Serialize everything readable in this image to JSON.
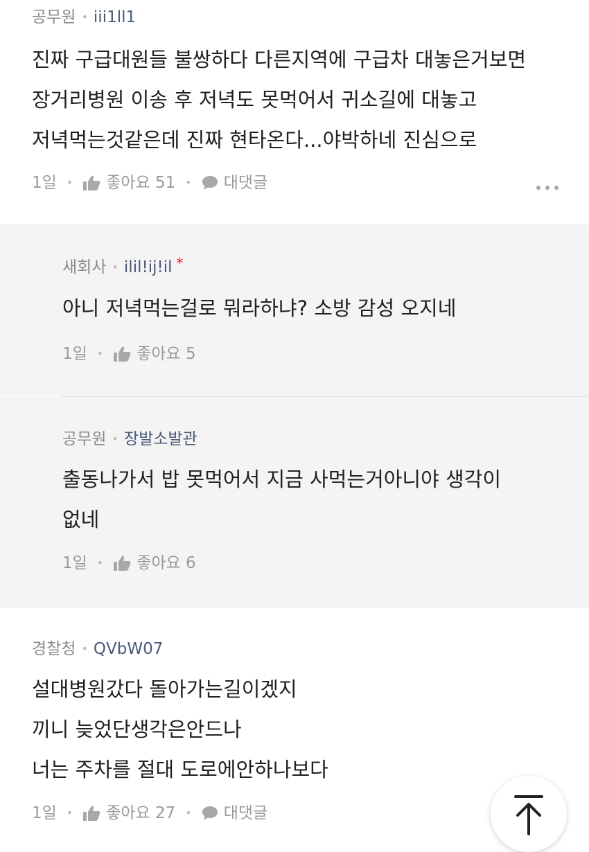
{
  "comments": [
    {
      "company": "공무원",
      "nickname": "iii1ll1",
      "body": "진짜 구급대원들 불쌍하다 다른지역에 구급차 대놓은거보면\n장거리병원 이송 후 저녁도 못먹어서 귀소길에 대놓고\n저녁먹는것같은데 진짜 현타온다...야박하네 진심으로",
      "time": "1일",
      "like_label": "좋아요 51",
      "reply_label": "대댓글"
    },
    {
      "company": "새회사",
      "nickname": "ilil!ij!il",
      "author_marker": "*",
      "body": "아니 저녁먹는걸로 뭐라하냐? 소방 감성 오지네",
      "time": "1일",
      "like_label": "좋아요 5"
    },
    {
      "company": "공무원",
      "nickname": "장발소발관",
      "body": "출동나가서 밥 못먹어서 지금 사먹는거아니야 생각이\n없네",
      "time": "1일",
      "like_label": "좋아요 6"
    },
    {
      "company": "경찰청",
      "nickname": "QVbW07",
      "body": "설대병원갔다 돌아가는길이겠지\n끼니 늦었단생각은안드나\n너는 주차를 절대 도로에안하나보다",
      "time": "1일",
      "like_label": "좋아요 27",
      "reply_label": "대댓글"
    }
  ],
  "separator": "•",
  "icons": {
    "like": "thumbs-up-icon",
    "reply": "speech-bubble-icon",
    "more": "more-dots-icon",
    "scroll_top": "arrow-up-icon"
  },
  "colors": {
    "nickname": "#4a5a7a",
    "meta_gray": "#9a9a9a",
    "reply_background": "#f4f4f4",
    "author_marker": "#e02d2d"
  }
}
